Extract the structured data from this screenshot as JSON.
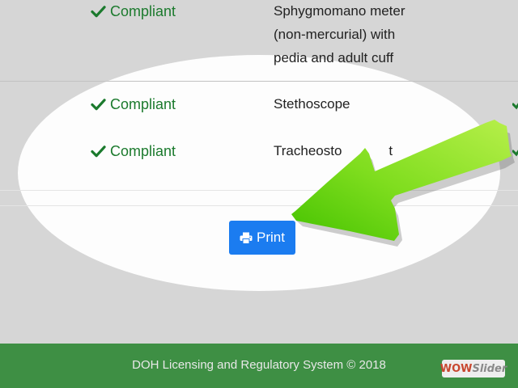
{
  "rows": [
    {
      "status": "Compliant",
      "equipment_lines": [
        "Sphygmomano meter",
        "(non-mercurial) with",
        "pedia and adult cuff"
      ]
    },
    {
      "status": "Compliant",
      "equipment_lines": [
        "Stethoscope"
      ]
    },
    {
      "status": "Compliant",
      "equipment_lines": [
        "Tracheosto",
        "t"
      ]
    }
  ],
  "print_button": {
    "label": "Print",
    "icon": "printer-icon"
  },
  "footer": {
    "text": "DOH Licensing and Regulatory System © 2018"
  },
  "watermark": {
    "part1": "WOW",
    "part2": "Slider"
  },
  "colors": {
    "compliant": "#1b7a2d",
    "button": "#1b7cf0",
    "footer": "#3e8f44",
    "arrow": "#7fdd1e"
  }
}
